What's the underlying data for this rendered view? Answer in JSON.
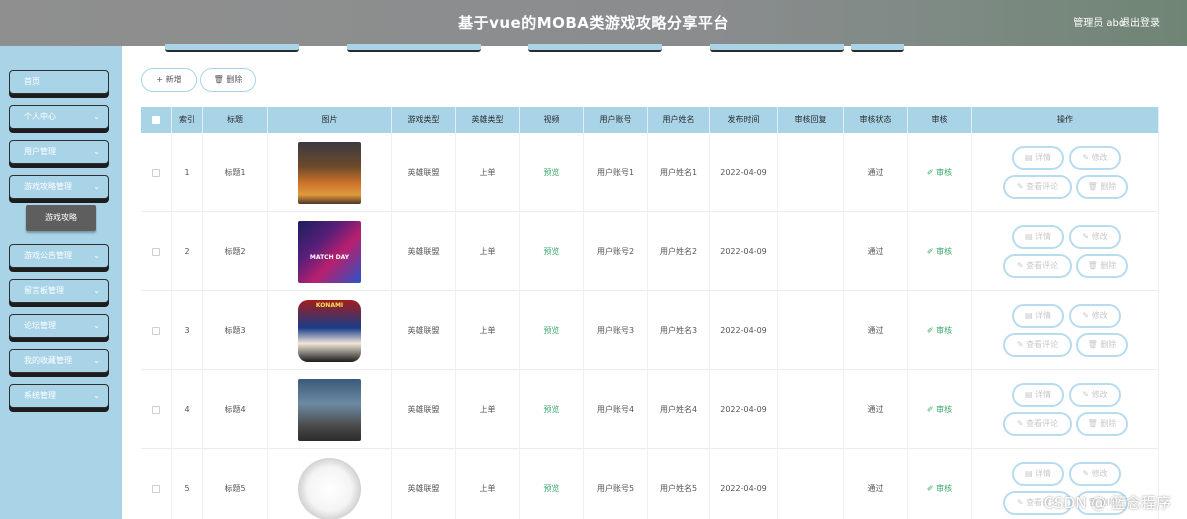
{
  "header": {
    "title": "基于vue的MOBA类游戏攻略分享平台",
    "user": "管理员 abo",
    "logout": "退出登录"
  },
  "sidebar": {
    "items": [
      {
        "label": "首页",
        "arrow": ""
      },
      {
        "label": "个人中心",
        "arrow": "⌄"
      },
      {
        "label": "用户管理",
        "arrow": "⌄"
      },
      {
        "label": "游戏攻略管理",
        "arrow": "⌄"
      },
      {
        "label": "游戏公告管理",
        "arrow": "⌄"
      },
      {
        "label": "留言板管理",
        "arrow": "⌄"
      },
      {
        "label": "论坛管理",
        "arrow": "⌄"
      },
      {
        "label": "我的收藏管理",
        "arrow": "⌄"
      },
      {
        "label": "系统管理",
        "arrow": "⌄"
      }
    ],
    "submenu": {
      "label": "游戏攻略"
    }
  },
  "toolbar": {
    "add_label": "+ 新增",
    "delete_label": "🗑 删除"
  },
  "table": {
    "headers": [
      "",
      "索引",
      "标题",
      "图片",
      "游戏类型",
      "英雄类型",
      "视频",
      "用户账号",
      "用户姓名",
      "发布时间",
      "审核回复",
      "审核状态",
      "审核",
      "操作"
    ],
    "rows": [
      {
        "index": "1",
        "title": "标题1",
        "game_type": "英雄联盟",
        "hero_type": "上单",
        "video": "预览",
        "account": "用户账号1",
        "name": "用户姓名1",
        "date": "2022-04-09",
        "reply": "",
        "status": "通过",
        "audit": "✐ 审核",
        "image": "t1",
        "caption": ""
      },
      {
        "index": "2",
        "title": "标题2",
        "game_type": "英雄联盟",
        "hero_type": "上单",
        "video": "预览",
        "account": "用户账号2",
        "name": "用户姓名2",
        "date": "2022-04-09",
        "reply": "",
        "status": "通过",
        "audit": "✐ 审核",
        "image": "t2",
        "caption": "MATCH DAY"
      },
      {
        "index": "3",
        "title": "标题3",
        "game_type": "英雄联盟",
        "hero_type": "上单",
        "video": "预览",
        "account": "用户账号3",
        "name": "用户姓名3",
        "date": "2022-04-09",
        "reply": "",
        "status": "通过",
        "audit": "✐ 审核",
        "image": "t3",
        "caption": "KONAMI"
      },
      {
        "index": "4",
        "title": "标题4",
        "game_type": "英雄联盟",
        "hero_type": "上单",
        "video": "预览",
        "account": "用户账号4",
        "name": "用户姓名4",
        "date": "2022-04-09",
        "reply": "",
        "status": "通过",
        "audit": "✐ 审核",
        "image": "t4",
        "caption": ""
      },
      {
        "index": "5",
        "title": "标题5",
        "game_type": "英雄联盟",
        "hero_type": "上单",
        "video": "预览",
        "account": "用户账号5",
        "name": "用户姓名5",
        "date": "2022-04-09",
        "reply": "",
        "status": "通过",
        "audit": "✐ 审核",
        "image": "t5",
        "caption": ""
      }
    ],
    "ops": {
      "detail": "▤ 详情",
      "edit": "✎ 修改",
      "comments": "✎ 查看评论",
      "delete": "🗑 删除"
    }
  },
  "watermark": "CSDN @ 蓝念程序"
}
